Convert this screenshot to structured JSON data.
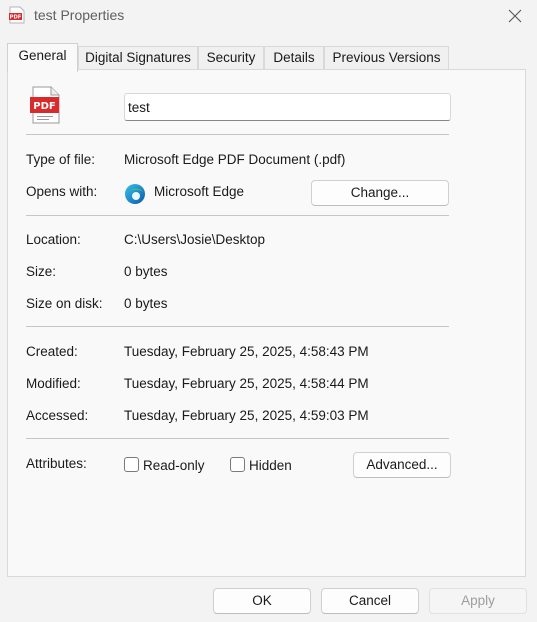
{
  "window": {
    "title": "test Properties",
    "icon": "pdf-file-icon",
    "close_icon": "close-icon"
  },
  "tabs": [
    {
      "label": "General",
      "active": true
    },
    {
      "label": "Digital Signatures",
      "active": false
    },
    {
      "label": "Security",
      "active": false
    },
    {
      "label": "Details",
      "active": false
    },
    {
      "label": "Previous Versions",
      "active": false
    }
  ],
  "general": {
    "file_name": "test",
    "file_icon_text": "PDF",
    "type_label": "Type of file:",
    "type_value": "Microsoft Edge PDF Document (.pdf)",
    "opens_label": "Opens with:",
    "opens_value": "Microsoft Edge",
    "change_button": "Change...",
    "location_label": "Location:",
    "location_value": "C:\\Users\\Josie\\Desktop",
    "size_label": "Size:",
    "size_value": "0 bytes",
    "size_on_disk_label": "Size on disk:",
    "size_on_disk_value": "0 bytes",
    "created_label": "Created:",
    "created_value": "Tuesday, February 25, 2025, 4:58:43 PM",
    "modified_label": "Modified:",
    "modified_value": "Tuesday, February 25, 2025, 4:58:44 PM",
    "accessed_label": "Accessed:",
    "accessed_value": "Tuesday, February 25, 2025, 4:59:03 PM",
    "attributes_label": "Attributes:",
    "readonly_label": "Read-only",
    "readonly_checked": false,
    "hidden_label": "Hidden",
    "hidden_checked": false,
    "advanced_button": "Advanced..."
  },
  "footer": {
    "ok": "OK",
    "cancel": "Cancel",
    "apply": "Apply",
    "apply_enabled": false
  },
  "colors": {
    "pdf_red": "#d92b2b",
    "edge_blue": "#0c59a4",
    "edge_green": "#4fc26b"
  }
}
